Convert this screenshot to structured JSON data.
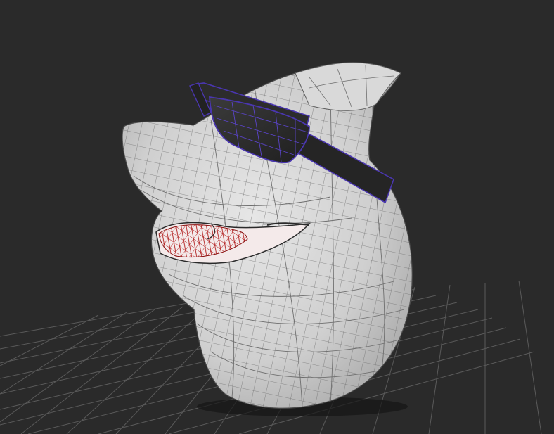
{
  "viewport": {
    "background_color": "#2a2a2a",
    "grid_color": "#5a5a5a",
    "mesh_fill_color": "#cfcfcf",
    "mesh_wire_color": "#6b6b6b",
    "sunglasses_color": "#3a2a8a",
    "sunglasses_wire_color": "#5a3cc8",
    "teeth_wire_color": "#b01818",
    "object_description_icon": "shark-head-model-icon"
  }
}
